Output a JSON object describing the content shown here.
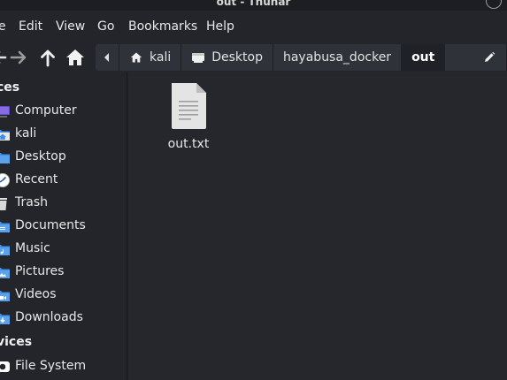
{
  "window": {
    "title": "out - Thunar"
  },
  "menu": {
    "items": [
      "e",
      "Edit",
      "View",
      "Go",
      "Bookmarks",
      "Help"
    ]
  },
  "toolbar": {
    "back_icon": "back-arrow-icon",
    "forward_icon": "forward-arrow-icon",
    "up_icon": "up-arrow-icon",
    "home_icon": "home-icon"
  },
  "pathbar": {
    "segments": [
      {
        "label": "kali",
        "icon": "home-icon"
      },
      {
        "label": "Desktop",
        "icon": "desktop-icon"
      },
      {
        "label": "hayabusa_docker",
        "icon": ""
      },
      {
        "label": "out",
        "icon": "",
        "active": true
      }
    ],
    "edit_icon": "pencil-icon"
  },
  "sidebar": {
    "places_heading": "ces",
    "places": [
      {
        "label": "Computer",
        "icon": "computer-icon"
      },
      {
        "label": "kali",
        "icon": "home-folder-icon"
      },
      {
        "label": "Desktop",
        "icon": "desktop-folder-icon"
      },
      {
        "label": "Recent",
        "icon": "recent-icon"
      },
      {
        "label": "Trash",
        "icon": "trash-icon"
      },
      {
        "label": "Documents",
        "icon": "documents-folder-icon"
      },
      {
        "label": "Music",
        "icon": "music-folder-icon"
      },
      {
        "label": "Pictures",
        "icon": "pictures-folder-icon"
      },
      {
        "label": "Videos",
        "icon": "videos-folder-icon"
      },
      {
        "label": "Downloads",
        "icon": "downloads-folder-icon"
      }
    ],
    "devices_heading": "vices",
    "devices": [
      {
        "label": "File System",
        "icon": "drive-icon"
      }
    ]
  },
  "files": [
    {
      "name": "out.txt",
      "icon": "text-file-icon"
    }
  ],
  "colors": {
    "background": "#23252b",
    "main_background": "#25272c",
    "folder_blue": "#3d8ee6",
    "pathbar_segment": "#2f3238",
    "pathbar_active": "#1f2126"
  }
}
